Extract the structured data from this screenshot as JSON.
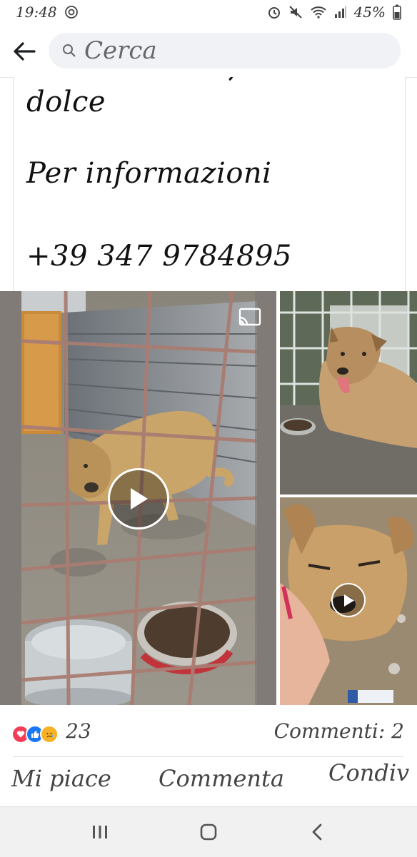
{
  "status_bar": {
    "time": "19:48",
    "battery": "45%",
    "icons": [
      "at-icon",
      "alarm-icon",
      "mute-icon",
      "wifi-icon",
      "signal-icon",
      "battery-icon"
    ]
  },
  "header": {
    "search_placeholder": "Cerca",
    "back_icon": "arrow-left-icon",
    "search_icon": "search-icon"
  },
  "post": {
    "lines": [
      "dolce",
      "Per informazioni",
      "+39 347 9784895"
    ]
  },
  "media": {
    "items": [
      {
        "kind": "video",
        "icons": [
          "play-icon",
          "cast-icon"
        ]
      },
      {
        "kind": "photo"
      },
      {
        "kind": "video",
        "icons": [
          "play-icon"
        ]
      }
    ]
  },
  "reactions": {
    "count": "23",
    "comments": "Commenti: 2",
    "icons": [
      "heart-icon",
      "like-icon",
      "sad-icon"
    ]
  },
  "actions": {
    "like": "Mi piace",
    "comment": "Commenta",
    "share": "Condiv"
  },
  "colors": {
    "accent": "#1877f2",
    "heart": "#f33e58",
    "sad": "#f7b125",
    "text_muted": "#65676b"
  },
  "nav": {
    "icons": [
      "recent-apps-icon",
      "home-icon",
      "back-icon"
    ]
  }
}
